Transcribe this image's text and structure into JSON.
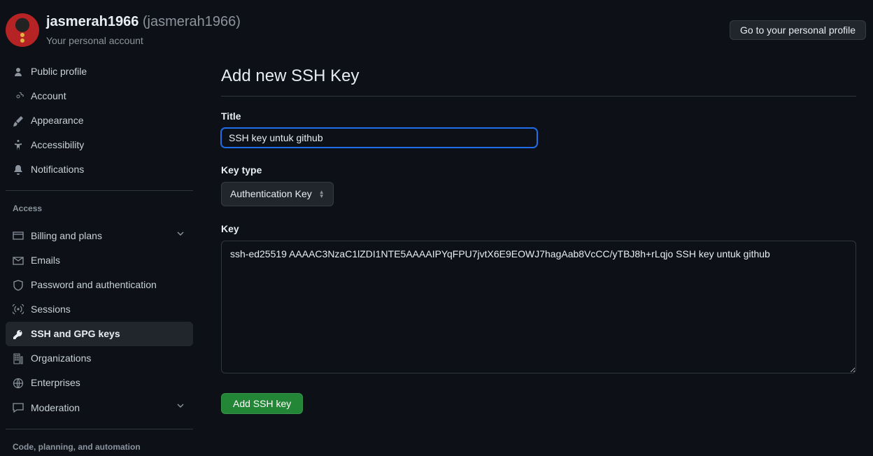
{
  "header": {
    "display_name": "jasmerah1966",
    "handle": "(jasmerah1966)",
    "subtitle": "Your personal account",
    "profile_button": "Go to your personal profile"
  },
  "sidebar": {
    "items": [
      {
        "id": "public-profile",
        "label": "Public profile",
        "icon": "person"
      },
      {
        "id": "account",
        "label": "Account",
        "icon": "gear"
      },
      {
        "id": "appearance",
        "label": "Appearance",
        "icon": "brush"
      },
      {
        "id": "accessibility",
        "label": "Accessibility",
        "icon": "accessibility"
      },
      {
        "id": "notifications",
        "label": "Notifications",
        "icon": "bell"
      }
    ],
    "section_access": "Access",
    "access_items": [
      {
        "id": "billing",
        "label": "Billing and plans",
        "icon": "card",
        "expandable": true
      },
      {
        "id": "emails",
        "label": "Emails",
        "icon": "mail"
      },
      {
        "id": "password",
        "label": "Password and authentication",
        "icon": "shield"
      },
      {
        "id": "sessions",
        "label": "Sessions",
        "icon": "broadcast"
      },
      {
        "id": "ssh",
        "label": "SSH and GPG keys",
        "icon": "key",
        "active": true
      },
      {
        "id": "orgs",
        "label": "Organizations",
        "icon": "org"
      },
      {
        "id": "enterprises",
        "label": "Enterprises",
        "icon": "globe"
      },
      {
        "id": "moderation",
        "label": "Moderation",
        "icon": "comment",
        "expandable": true
      }
    ],
    "section_code": "Code, planning, and automation"
  },
  "form": {
    "heading": "Add new SSH Key",
    "title_label": "Title",
    "title_value": "SSH key untuk github",
    "keytype_label": "Key type",
    "keytype_value": "Authentication Key",
    "key_label": "Key",
    "key_value": "ssh-ed25519 AAAAC3NzaC1lZDI1NTE5AAAAIPYqFPU7jvtX6E9EOWJ7hagAab8VcCC/yTBJ8h+rLqjo SSH key untuk github",
    "submit_label": "Add SSH key"
  }
}
